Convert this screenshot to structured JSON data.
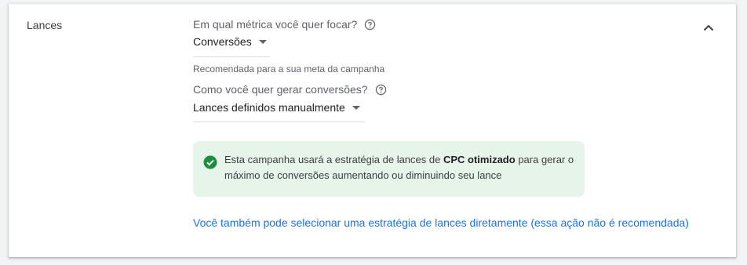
{
  "section": {
    "title": "Lances"
  },
  "metric": {
    "question": "Em qual métrica você quer focar?",
    "selected": "Conversões",
    "hint": "Recomendada para a sua meta da campanha"
  },
  "conversions": {
    "question": "Como você quer gerar conversões?",
    "selected": "Lances definidos manualmente"
  },
  "info": {
    "text_before": "Esta campanha usará a estratégia de lances de ",
    "strategy": "CPC otimizado",
    "text_after": " para gerar o máximo de conversões aumentando ou diminuindo seu lance",
    "icon": "check-circle-icon"
  },
  "link": {
    "label": "Você também pode selecionar uma estratégia de lances diretamente (essa ação não é recomendada)"
  },
  "icons": {
    "help": "help-circle-icon",
    "collapse": "chevron-up-icon",
    "dropdown": "caret-down-icon"
  },
  "colors": {
    "link": "#1a73e8",
    "success": "#1e8e3e",
    "info_bg": "#e6f4ea"
  }
}
